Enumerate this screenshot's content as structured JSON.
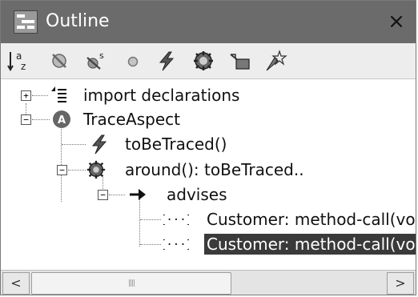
{
  "window": {
    "title": "Outline",
    "close_label": "×"
  },
  "toolbar": {
    "items": [
      {
        "icon": "sort-alphabetical-icon"
      },
      {
        "icon": "hide-fields-icon"
      },
      {
        "icon": "hide-static-icon"
      },
      {
        "icon": "hide-non-public-icon"
      },
      {
        "icon": "pointcut-icon"
      },
      {
        "icon": "advice-icon"
      },
      {
        "icon": "declare-icon"
      },
      {
        "icon": "introduction-icon"
      }
    ]
  },
  "tree": {
    "import_declarations": "import declarations",
    "aspect": "TraceAspect",
    "pointcut": "toBeTraced()",
    "advice": "around(): toBeTraced..",
    "advises": "advises",
    "call1": "Customer: method-call(void",
    "call2": "Customer: method-call(void",
    "expander_plus": "+",
    "expander_minus": "−"
  },
  "scrollbar": {
    "left_arrow": "<",
    "right_arrow": ">",
    "grip": "||||"
  }
}
